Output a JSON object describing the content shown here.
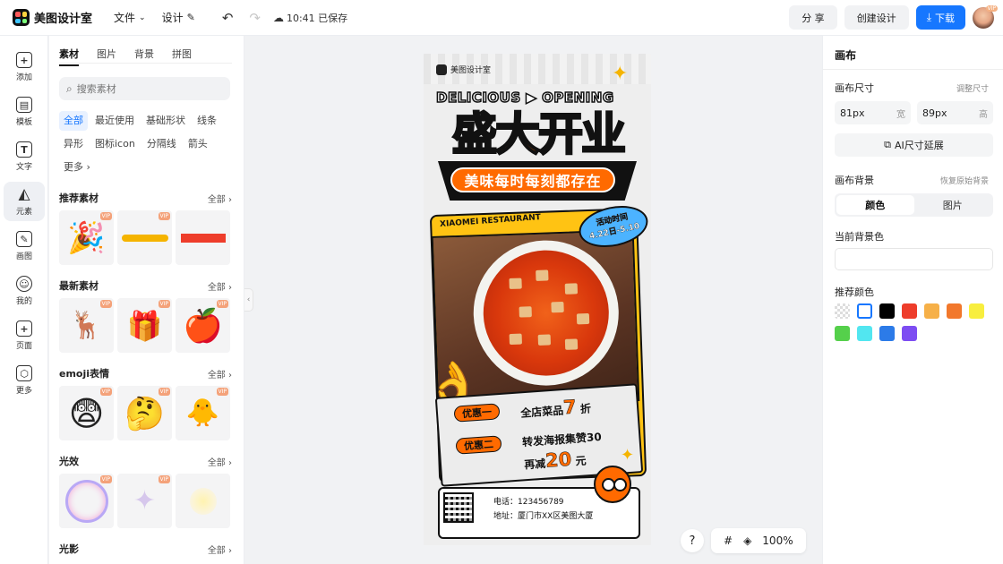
{
  "topbar": {
    "app_name": "美图设计室",
    "menu": [
      {
        "label": "文件"
      },
      {
        "label": "设计"
      }
    ],
    "save_status": "10:41 已保存",
    "share": "分 享",
    "create": "创建设计",
    "download": "下载",
    "avatar_vip": "VIP"
  },
  "leftnav": [
    {
      "label": "添加",
      "icon": "plus-square-icon"
    },
    {
      "label": "模板",
      "icon": "template-icon"
    },
    {
      "label": "文字",
      "icon": "text-icon"
    },
    {
      "label": "元素",
      "icon": "shapes-icon"
    },
    {
      "label": "画图",
      "icon": "draw-icon"
    },
    {
      "label": "我的",
      "icon": "user-icon"
    },
    {
      "label": "页面",
      "icon": "add-page-icon"
    },
    {
      "label": "更多",
      "icon": "cube-icon"
    }
  ],
  "panel": {
    "tabs": [
      "素材",
      "图片",
      "背景",
      "拼图"
    ],
    "search_placeholder": "搜索素材",
    "chips": [
      "全部",
      "最近使用",
      "基础形状",
      "线条",
      "异形",
      "图标icon",
      "分隔线",
      "箭头",
      "更多"
    ],
    "all_label": "全部",
    "vip": "VIP",
    "sections": [
      {
        "title": "推荐素材"
      },
      {
        "title": "最新素材"
      },
      {
        "title": "emoji表情"
      },
      {
        "title": "光效"
      },
      {
        "title": "光影"
      }
    ]
  },
  "poster": {
    "brand": "美图设计室",
    "headline_en": "DELICIOUS ▶ OPENING",
    "title": "盛大开业",
    "slogan": "美味每时每刻都存在",
    "restaurant": "XIAOMEI RESTAURANT",
    "date_label": "活动时间",
    "date_range": "4.22日-5.10",
    "deal1_tag": "优惠一",
    "deal1_text": "全店菜品",
    "deal1_num": "7",
    "deal1_unit": "折",
    "deal2_tag": "优惠二",
    "deal2_text": "转发海报集赞30",
    "deal2_prefix": "再减",
    "deal2_num": "20",
    "deal2_unit": "元",
    "phone": "电话：123456789",
    "address": "地址：厦门市XX区美图大厦"
  },
  "canvas_tools": {
    "help": "?",
    "zoom": "100%"
  },
  "rightpanel": {
    "title": "画布",
    "size_label": "画布尺寸",
    "resize_link": "调整尺寸",
    "width_value": "81px",
    "width_unit": "宽",
    "height_value": "89px",
    "height_unit": "高",
    "ai_extend": "AI尺寸延展",
    "bg_label": "画布背景",
    "restore_bg": "恢复原始背景",
    "bg_tabs": [
      "颜色",
      "图片"
    ],
    "current_bg_label": "当前背景色",
    "recommended_label": "推荐颜色",
    "swatches": [
      "transparent",
      "#ffffff",
      "#000000",
      "#ee3d2b",
      "#f6b048",
      "#f2782c",
      "#f8ee3e",
      "#55d04b",
      "#52e6f0",
      "#2c7be8",
      "#7d4df2"
    ]
  }
}
